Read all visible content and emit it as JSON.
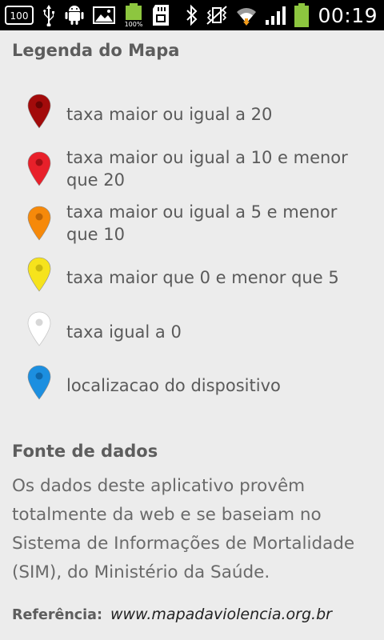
{
  "status_bar": {
    "time": "00:19",
    "badge_100_left": "100",
    "battery_badge": "100%"
  },
  "legend": {
    "title": "Legenda do Mapa",
    "items": [
      {
        "label": "taxa maior ou igual a 20",
        "color": "#a30b0b"
      },
      {
        "label": "taxa maior ou igual a 10 e menor que 20",
        "color": "#e8202a"
      },
      {
        "label": "taxa maior ou igual a 5 e menor que 10",
        "color": "#f6890a"
      },
      {
        "label": "taxa maior que 0 e menor que 5",
        "color": "#f6e31c"
      },
      {
        "label": "taxa igual a 0",
        "color": "#ffffff"
      },
      {
        "label": "localizacao do dispositivo",
        "color": "#1c8fe0"
      }
    ]
  },
  "source": {
    "title": "Fonte de dados",
    "text": "Os dados deste aplicativo provêm totalmente da web e se baseiam no Sistema de Informações de Mortalidade (SIM), do Ministério da Saúde."
  },
  "reference": {
    "label": "Referência:",
    "link": "www.mapadaviolencia.org.br"
  },
  "colors": {
    "background": "#ececec",
    "status_bar": "#000000",
    "battery_green": "#8dc63f"
  }
}
